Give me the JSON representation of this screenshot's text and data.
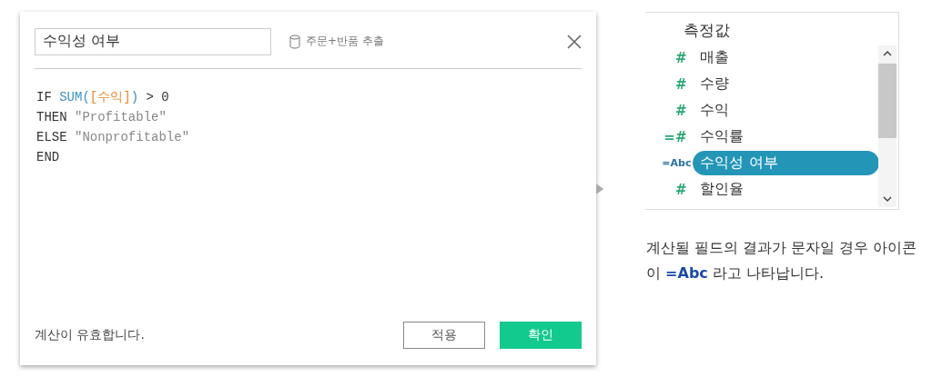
{
  "dialog": {
    "name_field": {
      "value": "수익성 여부"
    },
    "data_source": "주문+반품 추출",
    "code": [
      [
        {
          "kind": "keyword",
          "text": "IF "
        },
        {
          "kind": "function",
          "text": "SUM("
        },
        {
          "kind": "field",
          "text": "[수익]"
        },
        {
          "kind": "function",
          "text": ")"
        },
        {
          "kind": "plain",
          "text": " > 0"
        }
      ],
      [
        {
          "kind": "keyword",
          "text": "THEN "
        },
        {
          "kind": "string",
          "text": "\"Profitable\""
        }
      ],
      [
        {
          "kind": "keyword",
          "text": "ELSE "
        },
        {
          "kind": "string",
          "text": "\"Nonprofitable\""
        }
      ],
      [
        {
          "kind": "keyword",
          "text": "END"
        }
      ]
    ],
    "status": "계산이 유효합니다.",
    "buttons": [
      {
        "label": "적용",
        "kind": "secondary"
      },
      {
        "label": "확인",
        "kind": "primary"
      }
    ]
  },
  "measures": {
    "title": "측정값",
    "items": [
      {
        "icon": "#",
        "kind": "measure",
        "label": "매출",
        "selected": false
      },
      {
        "icon": "#",
        "kind": "measure",
        "label": "수량",
        "selected": false
      },
      {
        "icon": "#",
        "kind": "measure",
        "label": "수익",
        "selected": false
      },
      {
        "icon": "=#",
        "kind": "calc-measure",
        "label": "수익률",
        "selected": false
      },
      {
        "icon": "=Abc",
        "kind": "calc-string",
        "label": "수익성 여부",
        "selected": true
      },
      {
        "icon": "#",
        "kind": "measure",
        "label": "할인율",
        "selected": false
      }
    ]
  },
  "caption": "계산될 필드의 결과가 문자일 경우 아이콘이 **=Abc** 라고 나타납니다."
}
